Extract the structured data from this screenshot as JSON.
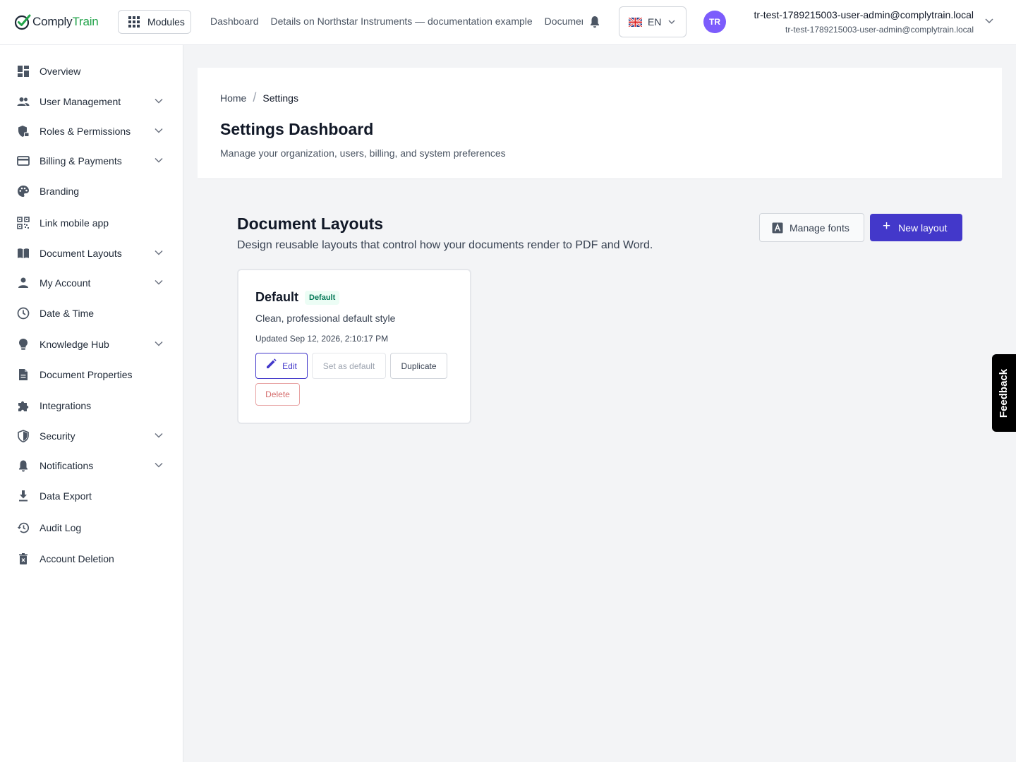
{
  "app": {
    "logo_text_dark": "Comply",
    "logo_text_green": "Train",
    "brand_green": "#22a34a",
    "accent": "#4338ca"
  },
  "topbar": {
    "modules_label": "Modules",
    "nav_links": [
      "Dashboard",
      "Details on Northstar Instruments — documentation example",
      "Documents"
    ],
    "language": "EN",
    "avatar_initials": "TR",
    "user_name": "tr-test-1789215003-user-admin@complytrain.local",
    "user_email": "tr-test-1789215003-user-admin@complytrain.local"
  },
  "sidebar": {
    "items": [
      {
        "label": "Overview",
        "icon": "dashboard-icon",
        "expandable": false
      },
      {
        "label": "User Management",
        "icon": "users-icon",
        "expandable": true
      },
      {
        "label": "Roles & Permissions",
        "icon": "shield-lock-icon",
        "expandable": true
      },
      {
        "label": "Billing & Payments",
        "icon": "credit-card-icon",
        "expandable": true
      },
      {
        "label": "Branding",
        "icon": "palette-icon",
        "expandable": false
      },
      {
        "label": "Link mobile app",
        "icon": "qr-code-icon",
        "expandable": false
      },
      {
        "label": "Document Layouts",
        "icon": "book-icon",
        "expandable": true
      },
      {
        "label": "My Account",
        "icon": "person-icon",
        "expandable": true
      },
      {
        "label": "Date & Time",
        "icon": "clock-icon",
        "expandable": false
      },
      {
        "label": "Knowledge Hub",
        "icon": "lightbulb-icon",
        "expandable": true
      },
      {
        "label": "Document Properties",
        "icon": "document-icon",
        "expandable": false
      },
      {
        "label": "Integrations",
        "icon": "puzzle-icon",
        "expandable": false
      },
      {
        "label": "Security",
        "icon": "shield-icon",
        "expandable": true
      },
      {
        "label": "Notifications",
        "icon": "bell-icon",
        "expandable": true
      },
      {
        "label": "Data Export",
        "icon": "download-icon",
        "expandable": false
      },
      {
        "label": "Audit Log",
        "icon": "history-icon",
        "expandable": false
      },
      {
        "label": "Account Deletion",
        "icon": "trash-icon",
        "expandable": false
      }
    ]
  },
  "header": {
    "breadcrumb_home": "Home",
    "breadcrumb_current": "Settings",
    "title": "Settings Dashboard",
    "subtitle": "Manage your organization, users, billing, and system preferences"
  },
  "layouts": {
    "title": "Document Layouts",
    "subtitle": "Design reusable layouts that control how your documents render to PDF and Word.",
    "manage_fonts_label": "Manage fonts",
    "new_layout_label": "New layout",
    "cards": [
      {
        "name": "Default",
        "badge": "Default",
        "description": "Clean, professional default style",
        "updated": "Updated Sep 12, 2026, 2:10:17 PM",
        "edit_label": "Edit",
        "set_default_label": "Set as default",
        "duplicate_label": "Duplicate",
        "delete_label": "Delete"
      }
    ]
  },
  "feedback_label": "Feedback"
}
